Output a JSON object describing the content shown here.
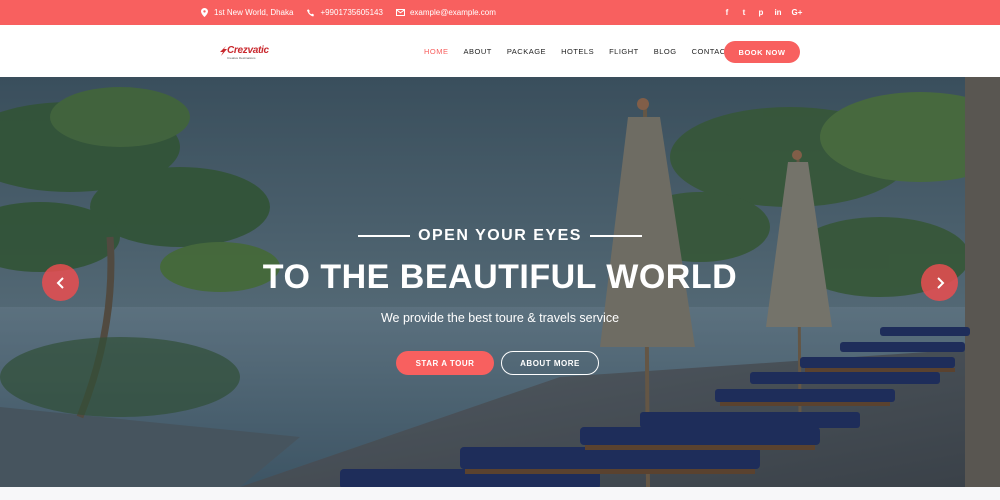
{
  "topbar": {
    "address": "1st New World, Dhaka",
    "phone": "+9901735605143",
    "email": "example@example.com",
    "social": [
      "f",
      "t",
      "p",
      "in",
      "G+"
    ]
  },
  "header": {
    "logo_text": "Crezvatic",
    "logo_tagline": "Creative Destinations",
    "nav": [
      "HOME",
      "ABOUT",
      "PACKAGE",
      "HOTELS",
      "FLIGHT",
      "BLOG",
      "CONTACT"
    ],
    "active_nav": "HOME",
    "book_now": "BOOK NOW"
  },
  "hero": {
    "eyebrow": "OPEN YOUR EYES",
    "headline": "TO THE BEAUTIFUL WORLD",
    "subtitle": "We provide the best toure & travels service",
    "primary_button": "STAR A TOUR",
    "secondary_button": "ABOUT MORE"
  },
  "colors": {
    "accent": "#f8605f",
    "white": "#ffffff"
  }
}
